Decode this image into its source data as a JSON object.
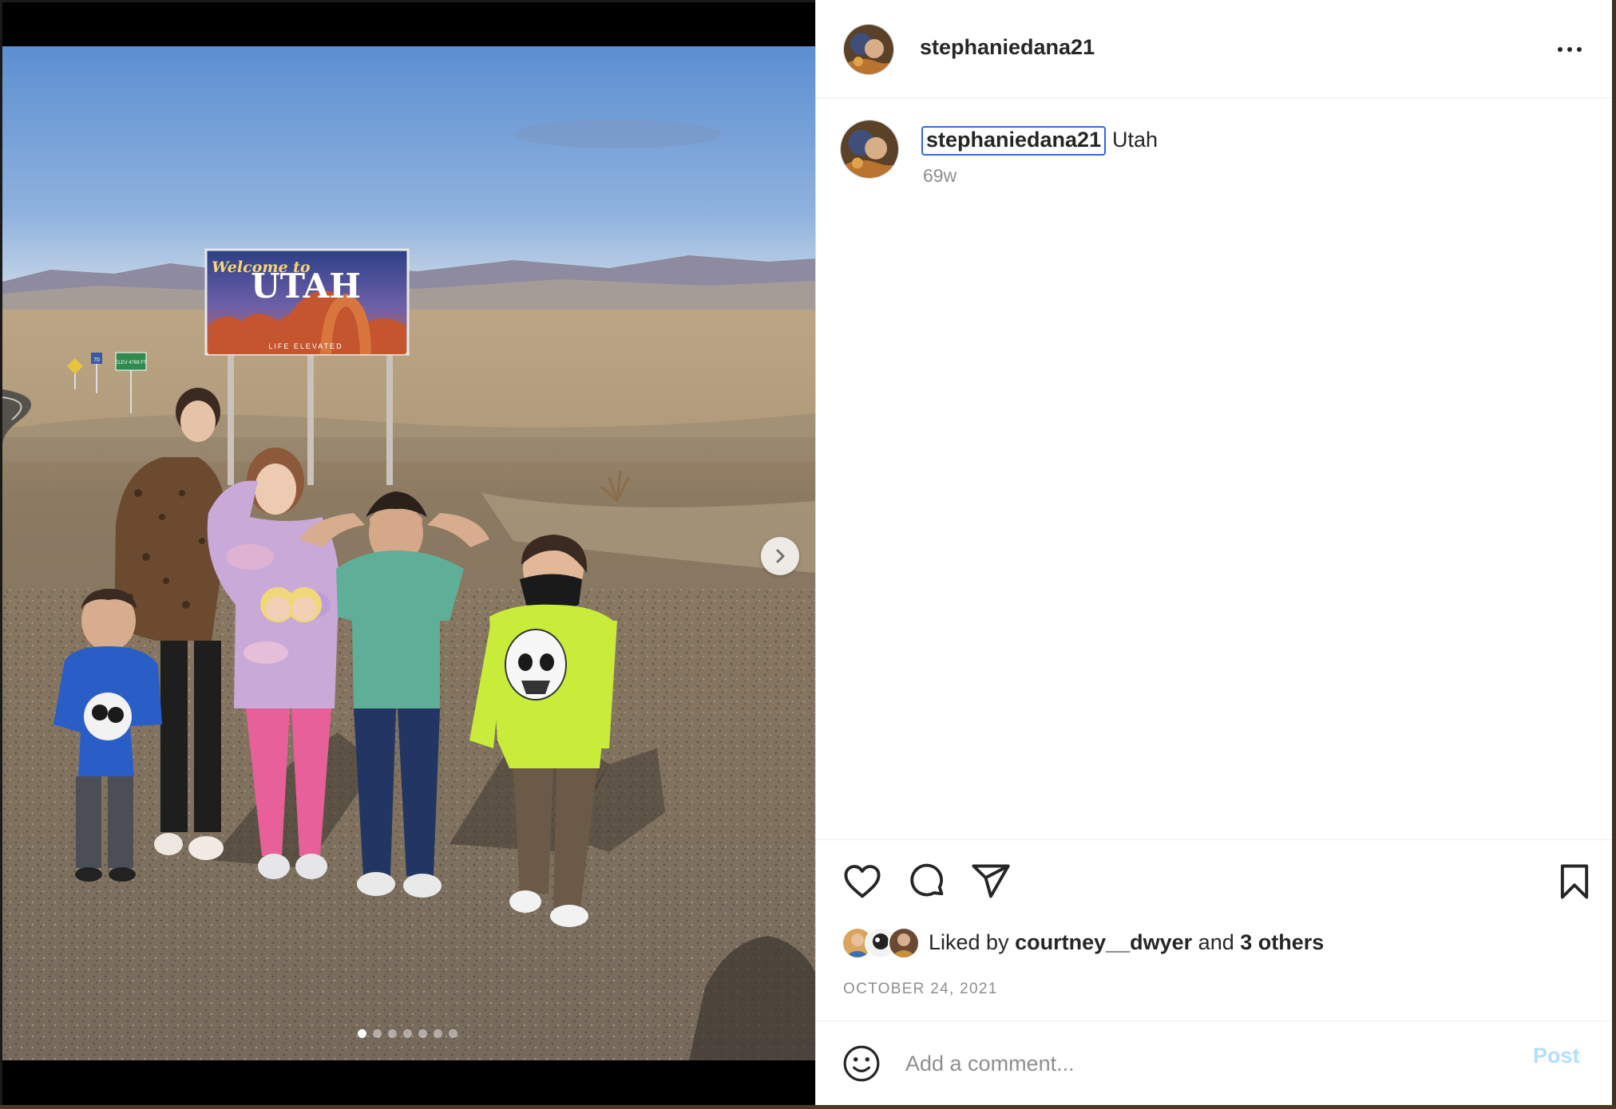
{
  "post": {
    "username": "stephaniedana21",
    "caption": "Utah",
    "time_ago": "69w",
    "likes": {
      "prefix": "Liked by ",
      "liker": "courtney__dwyer",
      "joiner": " and ",
      "others": "3 others"
    },
    "date": "OCTOBER 24, 2021"
  },
  "photo": {
    "sign_title_line1": "Welcome to",
    "sign_title_line2": "UTAH",
    "sign_tagline": "LIFE ELEVATED",
    "small_sign": "ELEV 4768 FT",
    "interstate": "70"
  },
  "carousel": {
    "total": 7,
    "active_index": 0
  },
  "comment": {
    "placeholder": "Add a comment...",
    "post_label": "Post"
  },
  "icons": {
    "more": "more-options-icon",
    "next": "chevron-right-icon",
    "like": "heart-icon",
    "comment": "comment-bubble-icon",
    "share": "paper-plane-icon",
    "save": "bookmark-icon",
    "emoji": "smiley-icon"
  },
  "colors": {
    "text": "#262626",
    "secondary_text": "#8e8e8e",
    "link_blue_faded": "#b2dffc",
    "focus_outline": "#2f6bd3",
    "divider": "#efefef"
  }
}
